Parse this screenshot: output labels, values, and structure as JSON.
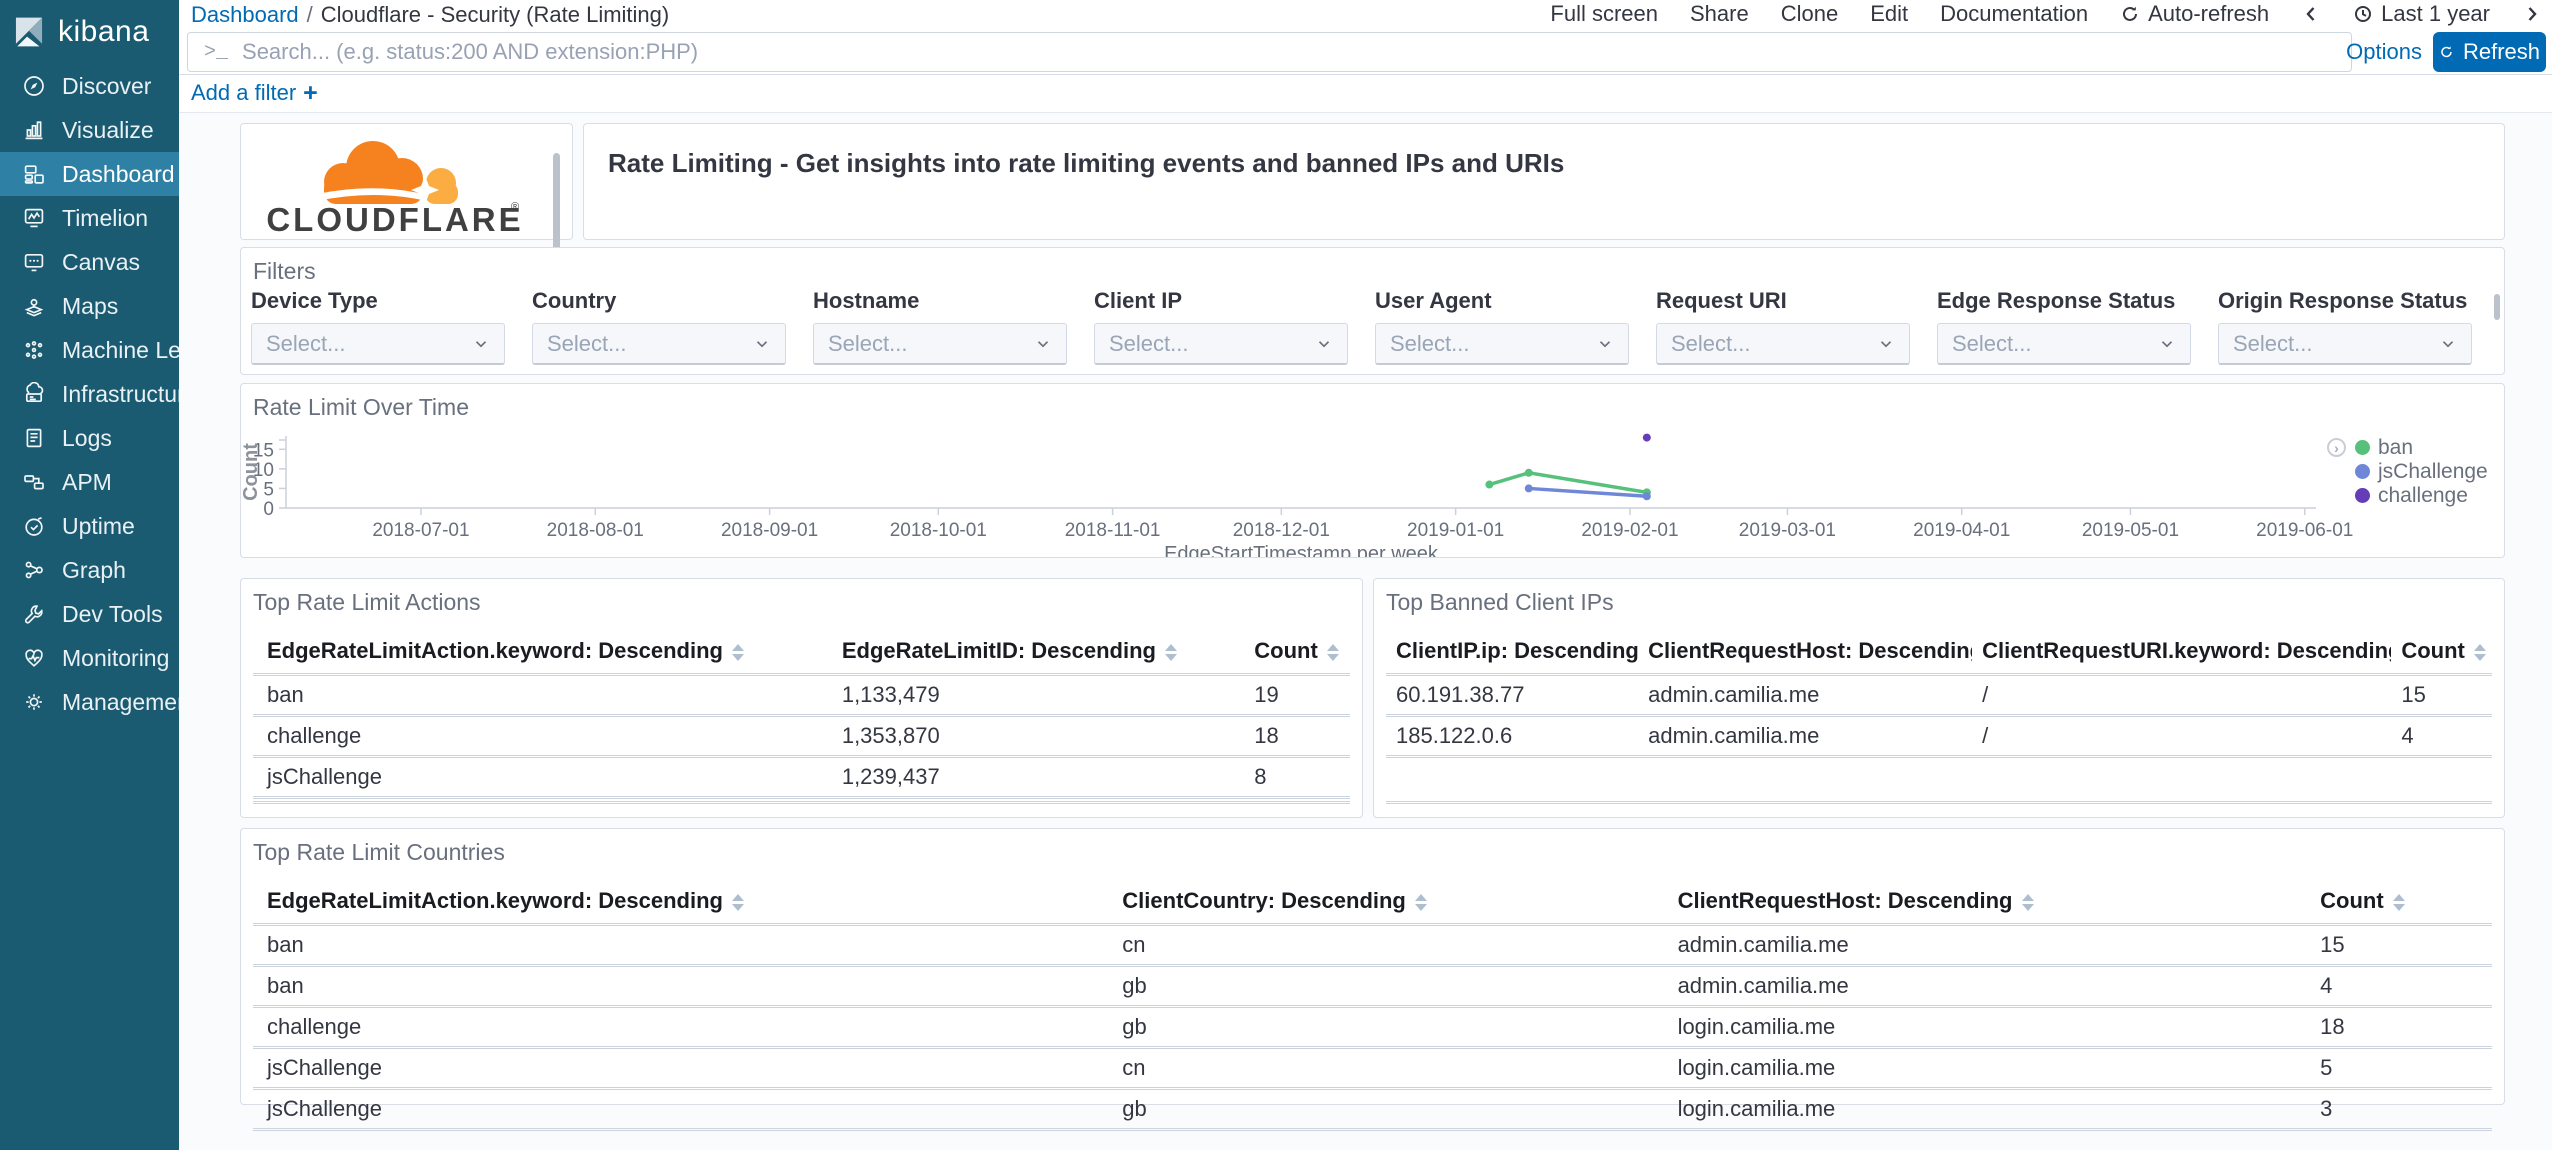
{
  "sidebar": {
    "logo_text": "kibana",
    "items": [
      {
        "label": "Discover",
        "icon": "discover"
      },
      {
        "label": "Visualize",
        "icon": "visualize"
      },
      {
        "label": "Dashboard",
        "icon": "dashboard",
        "active": true
      },
      {
        "label": "Timelion",
        "icon": "timelion"
      },
      {
        "label": "Canvas",
        "icon": "canvas"
      },
      {
        "label": "Maps",
        "icon": "maps"
      },
      {
        "label": "Machine Le...",
        "icon": "machine-learning"
      },
      {
        "label": "Infrastructure",
        "icon": "infrastructure"
      },
      {
        "label": "Logs",
        "icon": "logs"
      },
      {
        "label": "APM",
        "icon": "apm"
      },
      {
        "label": "Uptime",
        "icon": "uptime"
      },
      {
        "label": "Graph",
        "icon": "graph"
      },
      {
        "label": "Dev Tools",
        "icon": "dev-tools"
      },
      {
        "label": "Monitoring",
        "icon": "monitoring"
      },
      {
        "label": "Management",
        "icon": "management"
      }
    ]
  },
  "topbar": {
    "breadcrumb": {
      "link": "Dashboard",
      "separator": "/",
      "current": "Cloudflare - Security (Rate Limiting)"
    },
    "menu_items": [
      "Full screen",
      "Share",
      "Clone",
      "Edit",
      "Documentation"
    ],
    "auto_refresh_label": "Auto-refresh",
    "time_range_label": "Last 1 year"
  },
  "search": {
    "prompt_symbol": ">_",
    "placeholder": "Search... (e.g. status:200 AND extension:PHP)",
    "options_label": "Options",
    "refresh_label": "Refresh"
  },
  "filter_bar": {
    "add_filter_label": "Add a filter",
    "plus_symbol": "+"
  },
  "panels": {
    "logo": {
      "brand": "CLOUDFLARE",
      "registered_mark": "®"
    },
    "banner": {
      "text": "Rate Limiting - Get insights into rate limiting events and banned IPs and URIs"
    },
    "filters": {
      "title": "Filters",
      "controls": [
        {
          "label": "Device Type",
          "placeholder": "Select..."
        },
        {
          "label": "Country",
          "placeholder": "Select..."
        },
        {
          "label": "Hostname",
          "placeholder": "Select..."
        },
        {
          "label": "Client IP",
          "placeholder": "Select..."
        },
        {
          "label": "User Agent",
          "placeholder": "Select..."
        },
        {
          "label": "Request URI",
          "placeholder": "Select..."
        },
        {
          "label": "Edge Response Status",
          "placeholder": "Select..."
        },
        {
          "label": "Origin Response Status",
          "placeholder": "Select..."
        }
      ]
    },
    "actions_table": {
      "title": "Top Rate Limit Actions",
      "columns": [
        "EdgeRateLimitAction.keyword: Descending",
        "EdgeRateLimitID: Descending",
        "Count"
      ],
      "rows": [
        [
          "ban",
          "1,133,479",
          "19"
        ],
        [
          "challenge",
          "1,353,870",
          "18"
        ],
        [
          "jsChallenge",
          "1,239,437",
          "8"
        ]
      ]
    },
    "ips_table": {
      "title": "Top Banned Client IPs",
      "columns": [
        "ClientIP.ip: Descending",
        "ClientRequestHost: Descending",
        "ClientRequestURI.keyword: Descending",
        "Count"
      ],
      "rows": [
        [
          "60.191.38.77",
          "admin.camilia.me",
          "/",
          "15"
        ],
        [
          "185.122.0.6",
          "admin.camilia.me",
          "/",
          "4"
        ]
      ]
    },
    "countries_table": {
      "title": "Top Rate Limit Countries",
      "columns": [
        "EdgeRateLimitAction.keyword: Descending",
        "ClientCountry: Descending",
        "ClientRequestHost: Descending",
        "Count"
      ],
      "rows": [
        [
          "ban",
          "cn",
          "admin.camilia.me",
          "15"
        ],
        [
          "ban",
          "gb",
          "admin.camilia.me",
          "4"
        ],
        [
          "challenge",
          "gb",
          "login.camilia.me",
          "18"
        ],
        [
          "jsChallenge",
          "cn",
          "login.camilia.me",
          "5"
        ],
        [
          "jsChallenge",
          "gb",
          "login.camilia.me",
          "3"
        ]
      ]
    }
  },
  "chart_data": {
    "type": "line",
    "title": "Rate Limit Over Time",
    "xlabel": "EdgeStartTimestamp per week",
    "ylabel": "Count",
    "x_domain": [
      "2018-06-07",
      "2019-06-03"
    ],
    "x_ticks": [
      "2018-07-01",
      "2018-08-01",
      "2018-09-01",
      "2018-10-01",
      "2018-11-01",
      "2018-12-01",
      "2019-01-01",
      "2019-02-01",
      "2019-03-01",
      "2019-04-01",
      "2019-05-01",
      "2019-06-01"
    ],
    "y_ticks": [
      0,
      5,
      10,
      15
    ],
    "ylim": [
      0,
      18.4
    ],
    "grid": false,
    "legend_position": "right",
    "series": [
      {
        "name": "ban",
        "color": "#57c17b",
        "points": [
          [
            "2019-01-07",
            6
          ],
          [
            "2019-01-14",
            9
          ],
          [
            "2019-02-04",
            4
          ]
        ]
      },
      {
        "name": "jsChallenge",
        "color": "#6f87d8",
        "points": [
          [
            "2019-01-14",
            5
          ],
          [
            "2019-02-04",
            3
          ]
        ]
      },
      {
        "name": "challenge",
        "color": "#663db8",
        "points": [
          [
            "2019-02-04",
            18
          ]
        ]
      }
    ]
  },
  "colors": {
    "accent_blue": "#006bb4",
    "sidebar_bg": "#1b5b72",
    "sidebar_active_bg": "#2e81a4",
    "ban_green": "#57c17b",
    "jschallenge_blue": "#6f87d8",
    "challenge_purple": "#663db8",
    "cloudflare_orange": "#f6821f",
    "cloudflare_light_orange": "#fbad41"
  }
}
